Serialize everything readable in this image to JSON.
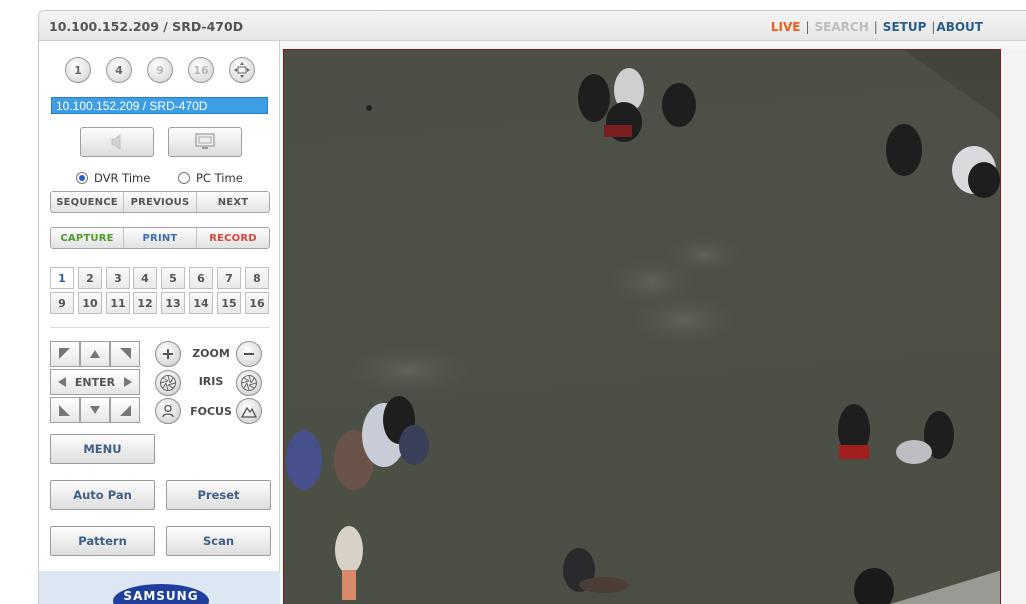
{
  "header": {
    "title": "10.100.152.209 / SRD-470D",
    "nav": {
      "live": "LIVE",
      "sep1": "|",
      "search": "SEARCH",
      "sep2": "|",
      "setup": "SETUP",
      "sep3": "|",
      "about": "ABOUT"
    }
  },
  "sidebar": {
    "layout_buttons": [
      "1",
      "4",
      "9",
      "16"
    ],
    "layout_fullscreen_icon": "fullscreen-arrows-icon",
    "camera_select": "10.100.152.209  / SRD-470D",
    "audio_icon": "speaker-icon",
    "monitor_icon": "monitor-icon",
    "time_options": {
      "dvr": "DVR Time",
      "pc": "PC Time",
      "selected": "DVR Time"
    },
    "sequence_bar": [
      "SEQUENCE",
      "PREVIOUS",
      "NEXT"
    ],
    "action_bar": [
      "CAPTURE",
      "PRINT",
      "RECORD"
    ],
    "channels": [
      "1",
      "2",
      "3",
      "4",
      "5",
      "6",
      "7",
      "8",
      "9",
      "10",
      "11",
      "12",
      "13",
      "14",
      "15",
      "16"
    ],
    "active_channel": "1",
    "ptz": {
      "enter": "ENTER",
      "zoom": "ZOOM",
      "iris": "IRIS",
      "focus": "FOCUS"
    },
    "buttons": {
      "menu": "MENU",
      "auto_pan": "Auto Pan",
      "preset": "Preset",
      "pattern": "Pattern",
      "scan": "Scan"
    },
    "brand": "SAMSUNG"
  },
  "colors": {
    "live": "#e8601c",
    "search_disabled": "#bdbdbd",
    "nav_link": "#2a5d8c",
    "camera_select_bg": "#3d9ee6",
    "video_border": "#8b1a1a",
    "brand_blue": "#1f3f9e"
  }
}
